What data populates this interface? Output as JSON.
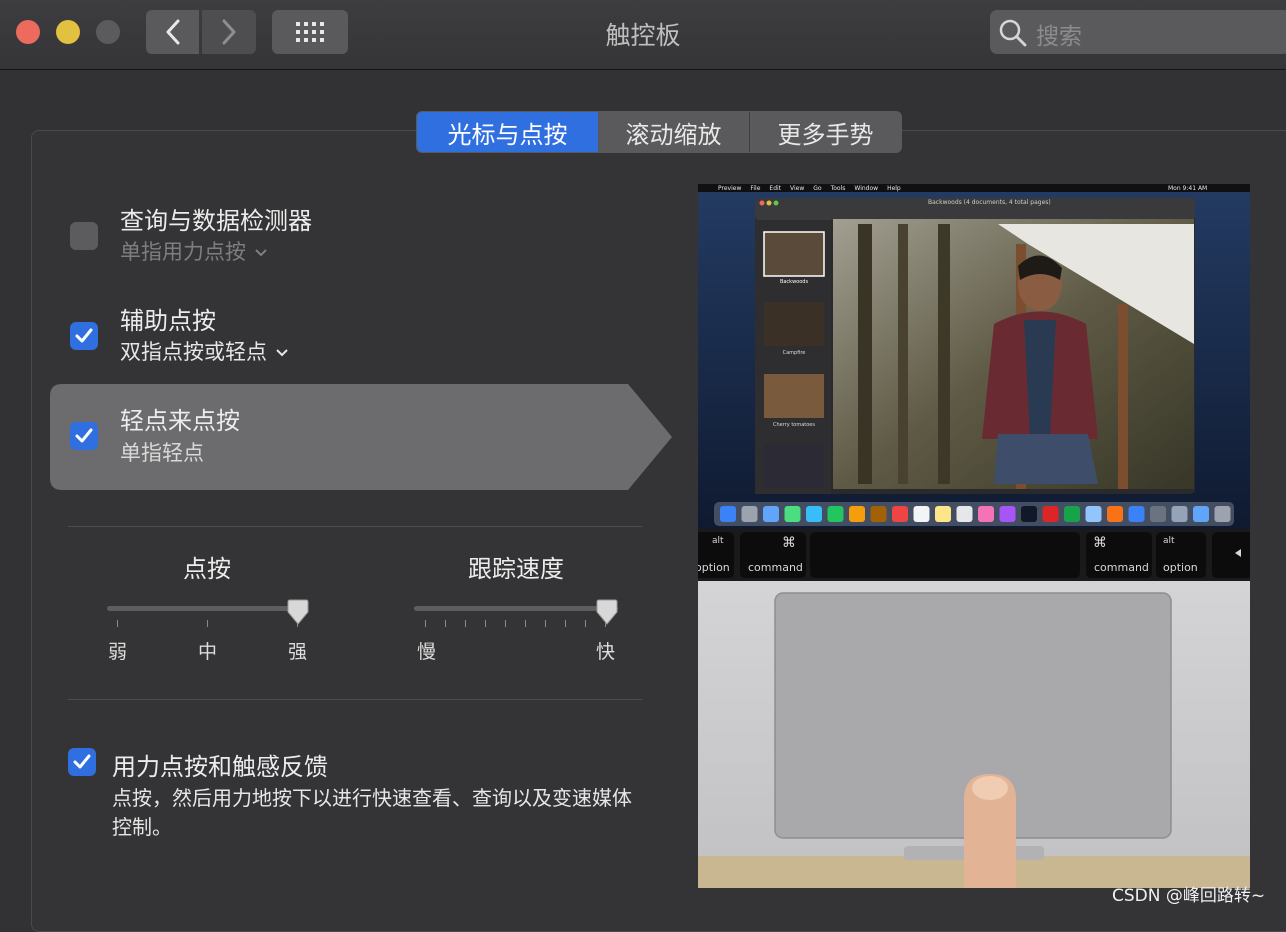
{
  "window": {
    "title": "触控板",
    "search_placeholder": "搜索"
  },
  "tabs": [
    {
      "label": "光标与点按",
      "selected": true
    },
    {
      "label": "滚动缩放",
      "selected": false
    },
    {
      "label": "更多手势",
      "selected": false
    }
  ],
  "options": [
    {
      "title": "查询与数据检测器",
      "subtitle": "单指用力点按",
      "checked": false,
      "has_menu": true
    },
    {
      "title": "辅助点按",
      "subtitle": "双指点按或轻点",
      "checked": true,
      "has_menu": true
    },
    {
      "title": "轻点来点按",
      "subtitle": "单指轻点",
      "checked": true,
      "has_menu": false
    }
  ],
  "sliders": {
    "click": {
      "title": "点按",
      "labels": [
        "弱",
        "中",
        "强"
      ],
      "value": 1.0
    },
    "tracking": {
      "title": "跟踪速度",
      "min_label": "慢",
      "max_label": "快",
      "value": 1.0
    }
  },
  "force_click": {
    "title": "用力点按和触感反馈",
    "description": "点按，然后用力地按下以进行快速查看、查询以及变速媒体控制。",
    "checked": true
  },
  "preview": {
    "menubar": [
      "Preview",
      "File",
      "Edit",
      "View",
      "Go",
      "Tools",
      "Window",
      "Help"
    ],
    "clock": "Mon 9:41 AM",
    "window_title": "Backwoods (4 documents, 4 total pages)",
    "thumbnails": [
      "Backwoods",
      "Campfire",
      "Cherry tomatoes",
      ""
    ],
    "keys": {
      "alt": "alt",
      "option": "option",
      "cmd_symbol": "⌘",
      "command": "command"
    }
  },
  "watermark": "CSDN @峰回路转~",
  "colors": {
    "accent": "#2f6fe0",
    "background": "#323234"
  }
}
